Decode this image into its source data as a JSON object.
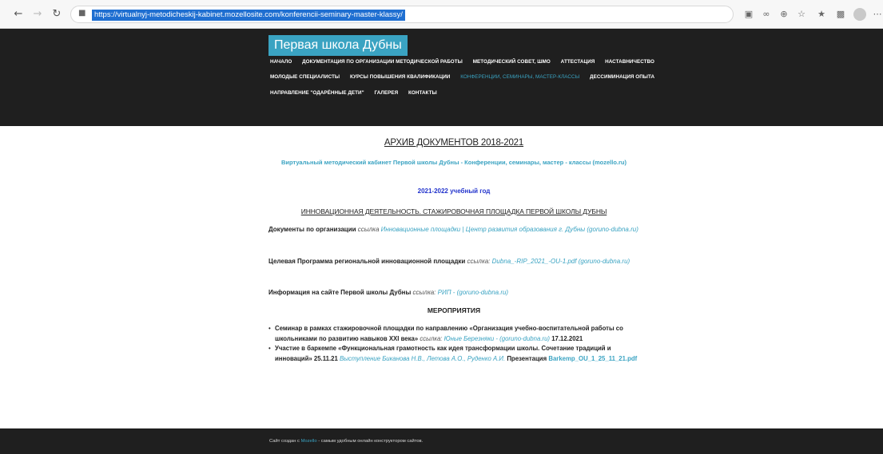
{
  "browser": {
    "url": "https://virtualnyj-metodicheskij-kabinet.mozellosite.com/konferencii-seminary-master-klassy/",
    "icons": [
      "back-icon",
      "forward-icon",
      "reload-icon",
      "lock-icon"
    ]
  },
  "site": {
    "logo": "Первая школа Дубны",
    "menu_row1": [
      "НАЧАЛО",
      "ДОКУМЕНТАЦИЯ ПО ОРГАНИЗАЦИИ МЕТОДИЧЕСКОЙ РАБОТЫ",
      "МЕТОДИЧЕСКИЙ СОВЕТ, ШМО",
      "АТТЕСТАЦИЯ",
      "НАСТАВНИЧЕСТВО"
    ],
    "menu_row2": [
      "МОЛОДЫЕ СПЕЦИАЛИСТЫ",
      "КУРСЫ ПОВЫШЕНИЯ КВАЛИФИКАЦИИ",
      "КОНФЕРЕНЦИИ, СЕМИНАРЫ, МАСТЕР-КЛАССЫ",
      "ДЕССИМИНАЦИЯ ОПЫТА"
    ],
    "menu_row3": [
      "НАПРАВЛЕНИЕ \"ОДАРЁННЫЕ ДЕТИ\"",
      "ГАЛЕРЕЯ",
      "КОНТАКТЫ"
    ],
    "active_color": "#3aa3c2"
  },
  "content": {
    "archive_title": "АРХИВ ДОКУМЕНТОВ 2018-2021",
    "subtitle": "Виртуальный методический кабинет Первой школы Дубны - Конференции, семинары, мастер - классы (mozello.ru)",
    "year": "2021-2022 учебный год",
    "innov_title": "ИННОВАЦИОННАЯ ДЕЯТЕЛЬНОСТЬ. СТАЖИРОВОЧНАЯ ПЛОЩАДКА ПЕРВОЙ ШКОЛЫ ДУБНЫ",
    "p1_bold": "Документы по организации",
    "p1_ref": "ссылка",
    "p1_link": "Инновационные площадки | Центр развития образования г. Дубны (goruno-dubna.ru)",
    "p2_bold": "Целевая Программа региональной инновационной площадки",
    "p2_ref": "ссылка:",
    "p2_link": "Dubna_-RIP_2021_-OU-1.pdf (goruno-dubna.ru)",
    "p3_bold": "Информация на сайте Первой школы Дубны",
    "p3_ref": "ссылка:",
    "p3_link": "РИП - (goruno-dubna.ru)",
    "events_title": "МЕРОПРИЯТИЯ",
    "event1_bold": "Семинар в рамках стажировочной площадки по направлению «Организация учебно-воспитательной работы со школьниками по развитию навыков XXI века»",
    "event1_ref": "ссылка:",
    "event1_link": "Юные Березняки - (goruno-dubna.ru)",
    "event1_date": "17.12.2021",
    "event2_bold": "Участие в баркемпе «Функциональная грамотность как идея трансформации школы. Сочетание традиций и инноваций» 25.11.21",
    "event2_link": "Выступление Биканова Н.В., Летова А.О., Руденко А.И.",
    "event2_pres": "Презентация",
    "event2_file": "Barkemp_OU_1_25_11_21.pdf"
  },
  "footer": {
    "prefix": "Сайт создан с",
    "link": "Mozello",
    "suffix": "- самым удобным онлайн конструктором сайтов."
  }
}
